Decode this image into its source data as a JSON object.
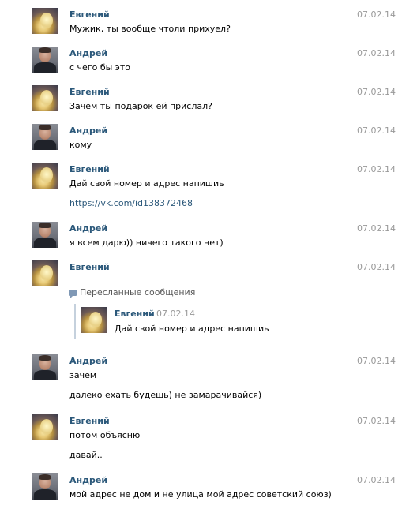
{
  "messages": [
    {
      "author": "Евгений",
      "date": "07.02.14",
      "lines": [
        "Мужик, ты вообще чтоли прихуел?"
      ]
    },
    {
      "author": "Андрей",
      "date": "07.02.14",
      "lines": [
        "с чего бы это"
      ]
    },
    {
      "author": "Евгений",
      "date": "07.02.14",
      "lines": [
        "Зачем ты подарок ей прислал?"
      ]
    },
    {
      "author": "Андрей",
      "date": "07.02.14",
      "lines": [
        "кому"
      ]
    },
    {
      "author": "Евгений",
      "date": "07.02.14",
      "lines": [
        "Дай свой номер и адрес напишиь"
      ],
      "link": "https://vk.com/id138372468"
    },
    {
      "author": "Андрей",
      "date": "07.02.14",
      "lines": [
        "я всем дарю)) ничего такого нет)"
      ]
    },
    {
      "author": "Евгений",
      "date": "07.02.14",
      "forwarded": {
        "header": "Пересланные сообщения",
        "author": "Евгений",
        "date": "07.02.14",
        "text": "Дай свой номер и адрес напишиь"
      }
    },
    {
      "author": "Андрей",
      "date": "07.02.14",
      "lines": [
        "зачем",
        "далеко ехать будешь) не замарачивайся)"
      ]
    },
    {
      "author": "Евгений",
      "date": "07.02.14",
      "lines": [
        "потом объясню",
        "давай.."
      ]
    },
    {
      "author": "Андрей",
      "date": "07.02.14",
      "lines": [
        "мой адрес не дом и не улица мой адрес советский союз)"
      ]
    }
  ],
  "icons": {
    "forwarded": "forwarded-messages-icon",
    "avatar_evgeny": "avatar-evgeny",
    "avatar_andrey": "avatar-andrey"
  },
  "colors": {
    "author": "#2b587a",
    "date": "#999999",
    "link": "#2b587a",
    "background": "#ffffff"
  }
}
